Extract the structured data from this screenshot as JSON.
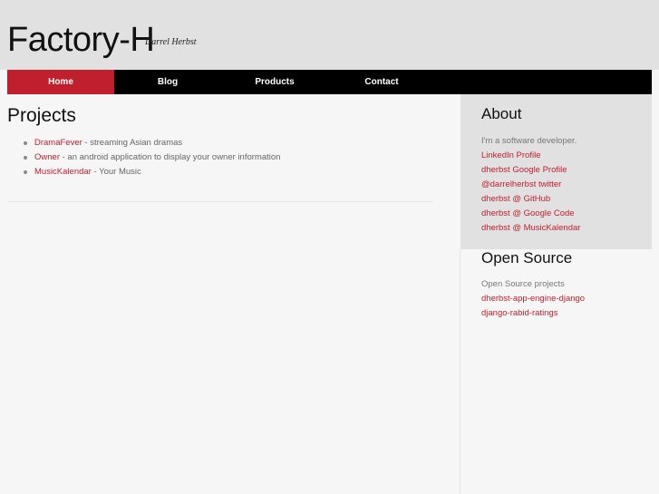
{
  "header": {
    "title": "Factory-H",
    "subtitle": "Darrel Herbst"
  },
  "nav": {
    "items": [
      {
        "label": "Home",
        "active": true
      },
      {
        "label": "Blog"
      },
      {
        "label": "Products"
      },
      {
        "label": "Contact"
      }
    ]
  },
  "main": {
    "title": "Projects",
    "projects": [
      {
        "name": "DramaFever",
        "desc": " - streaming Asian dramas"
      },
      {
        "name": "Owner",
        "desc": " - an android application to display your owner information"
      },
      {
        "name": "MusicKalendar",
        "desc": " - Your Music"
      }
    ]
  },
  "sidebar": {
    "about": {
      "title": "About",
      "intro": "I'm a software developer.",
      "links": [
        "LinkedIn Profile",
        "dherbst Google Profile",
        "@darrelherbst twitter",
        "dherbst @ GitHub",
        "dherbst @ Google Code",
        "dherbst @ MusicKalendar"
      ]
    },
    "open_source": {
      "title": "Open Source",
      "intro": "Open Source projects",
      "links": [
        "dherbst-app-engine-django",
        "django-rabid-ratings"
      ]
    }
  },
  "colors": {
    "accent": "#c0202e",
    "nav_bg": "#000000",
    "header_bg": "#e1e1e1",
    "page_bg": "#f6f6f6"
  }
}
